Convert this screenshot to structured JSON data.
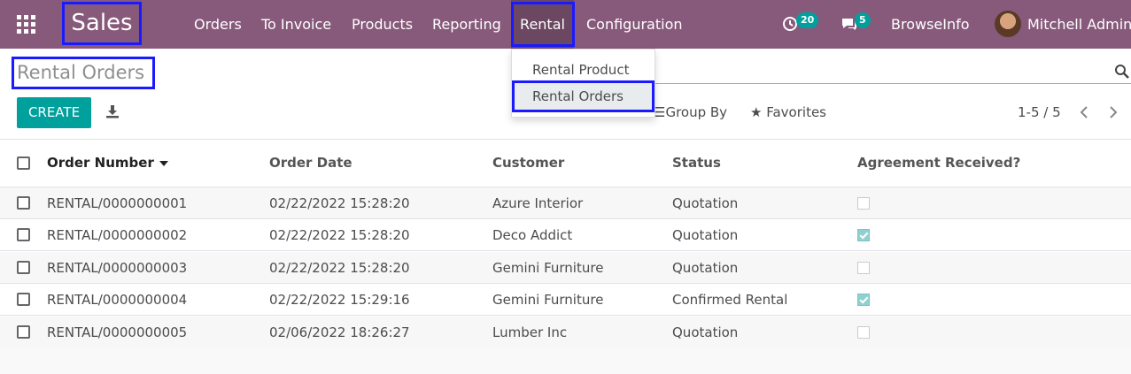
{
  "navbar": {
    "app_name": "Sales",
    "menu": {
      "orders": "Orders",
      "to_invoice": "To Invoice",
      "products": "Products",
      "reporting": "Reporting",
      "rental": "Rental",
      "configuration": "Configuration"
    },
    "activity_count": "20",
    "message_count": "5",
    "company": "BrowseInfo",
    "user": "Mitchell Admin"
  },
  "dropdown": {
    "items": [
      "Rental Product",
      "Rental Orders"
    ]
  },
  "control_panel": {
    "title": "Rental Orders",
    "create_label": "CREATE",
    "group_by": "Group By",
    "favorites": "Favorites",
    "pager": "1-5 / 5"
  },
  "table": {
    "headers": {
      "order_number": "Order Number",
      "order_date": "Order Date",
      "customer": "Customer",
      "status": "Status",
      "agreement": "Agreement Received?"
    },
    "rows": [
      {
        "order": "RENTAL/0000000001",
        "date": "02/22/2022 15:28:20",
        "customer": "Azure Interior",
        "status": "Quotation",
        "agreement": false
      },
      {
        "order": "RENTAL/0000000002",
        "date": "02/22/2022 15:28:20",
        "customer": "Deco Addict",
        "status": "Quotation",
        "agreement": true
      },
      {
        "order": "RENTAL/0000000003",
        "date": "02/22/2022 15:28:20",
        "customer": "Gemini Furniture",
        "status": "Quotation",
        "agreement": false
      },
      {
        "order": "RENTAL/0000000004",
        "date": "02/22/2022 15:29:16",
        "customer": "Gemini Furniture",
        "status": "Confirmed Rental",
        "agreement": true
      },
      {
        "order": "RENTAL/0000000005",
        "date": "02/06/2022 18:26:27",
        "customer": "Lumber Inc",
        "status": "Quotation",
        "agreement": false
      }
    ]
  },
  "colors": {
    "navbar": "#875a7b",
    "accent": "#00a09d",
    "highlight": "#1a1aff"
  }
}
